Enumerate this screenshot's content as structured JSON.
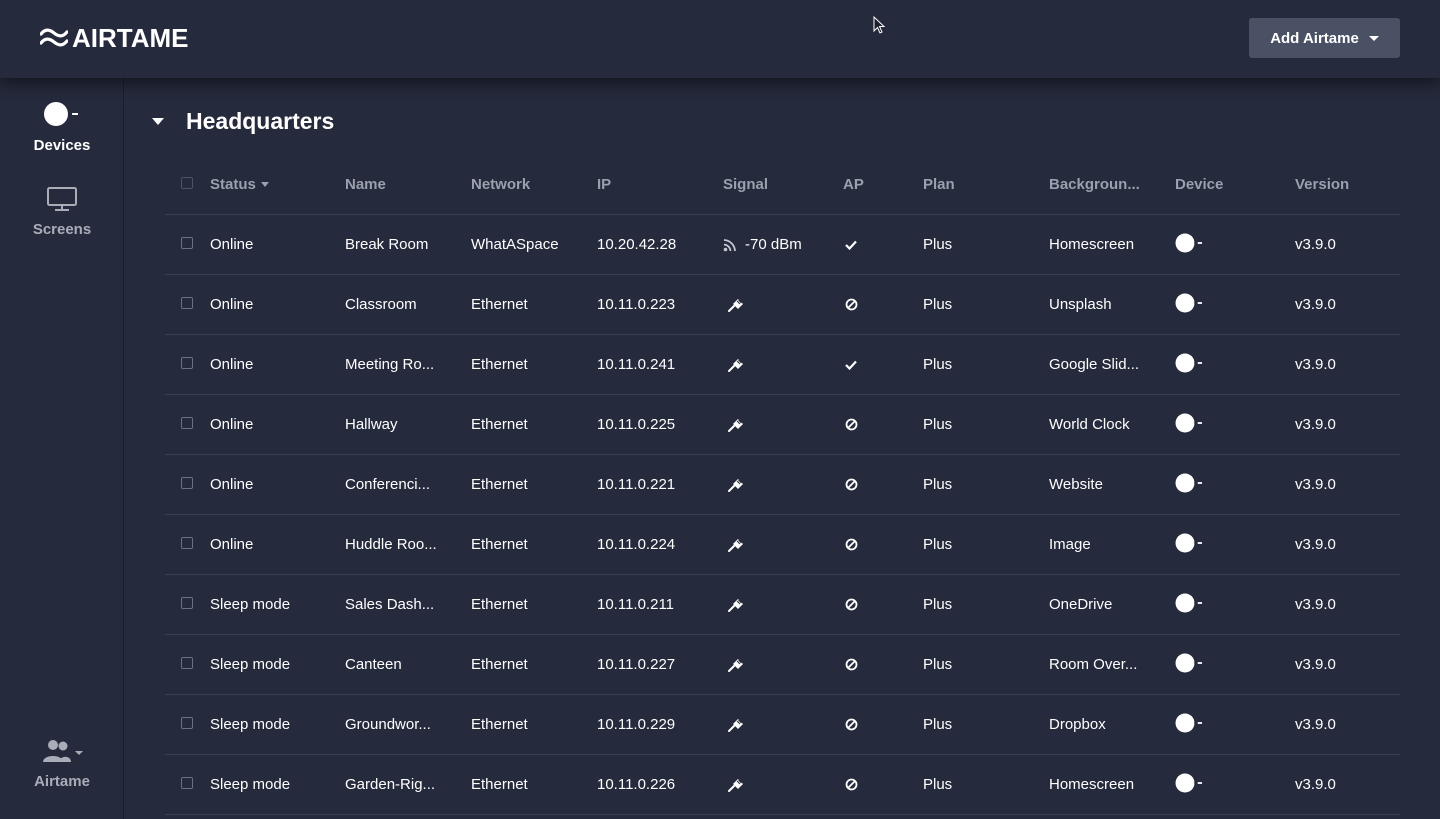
{
  "header": {
    "logo_text": "AIRTAME",
    "add_button_label": "Add Airtame"
  },
  "sidebar": {
    "items": [
      {
        "label": "Devices",
        "icon": "airtame-device-icon",
        "active": true
      },
      {
        "label": "Screens",
        "icon": "monitor-icon",
        "active": false
      }
    ],
    "account_label": "Airtame"
  },
  "group": {
    "title": "Headquarters"
  },
  "table": {
    "columns": [
      "Status",
      "Name",
      "Network",
      "IP",
      "Signal",
      "AP",
      "Plan",
      "Backgroun...",
      "Device",
      "Version"
    ],
    "rows": [
      {
        "status": "Online",
        "name": "Break Room",
        "network": "WhatASpace",
        "ip": "10.20.42.28",
        "signal_type": "wifi",
        "signal": "-70 dBm",
        "ap": "check",
        "plan": "Plus",
        "background": "Homescreen",
        "version": "v3.9.0"
      },
      {
        "status": "Online",
        "name": "Classroom",
        "network": "Ethernet",
        "ip": "10.11.0.223",
        "signal_type": "ethernet",
        "signal": "",
        "ap": "disabled",
        "plan": "Plus",
        "background": "Unsplash",
        "version": "v3.9.0"
      },
      {
        "status": "Online",
        "name": "Meeting Ro...",
        "network": "Ethernet",
        "ip": "10.11.0.241",
        "signal_type": "ethernet",
        "signal": "",
        "ap": "check",
        "plan": "Plus",
        "background": "Google Slid...",
        "version": "v3.9.0"
      },
      {
        "status": "Online",
        "name": "Hallway",
        "network": "Ethernet",
        "ip": "10.11.0.225",
        "signal_type": "ethernet",
        "signal": "",
        "ap": "disabled",
        "plan": "Plus",
        "background": "World Clock",
        "version": "v3.9.0"
      },
      {
        "status": "Online",
        "name": "Conferenci...",
        "network": "Ethernet",
        "ip": "10.11.0.221",
        "signal_type": "ethernet",
        "signal": "",
        "ap": "disabled",
        "plan": "Plus",
        "background": "Website",
        "version": "v3.9.0"
      },
      {
        "status": "Online",
        "name": "Huddle Roo...",
        "network": "Ethernet",
        "ip": "10.11.0.224",
        "signal_type": "ethernet",
        "signal": "",
        "ap": "disabled",
        "plan": "Plus",
        "background": "Image",
        "version": "v3.9.0"
      },
      {
        "status": "Sleep mode",
        "name": "Sales Dash...",
        "network": "Ethernet",
        "ip": "10.11.0.211",
        "signal_type": "ethernet",
        "signal": "",
        "ap": "disabled",
        "plan": "Plus",
        "background": "OneDrive",
        "version": "v3.9.0"
      },
      {
        "status": "Sleep mode",
        "name": "Canteen",
        "network": "Ethernet",
        "ip": "10.11.0.227",
        "signal_type": "ethernet",
        "signal": "",
        "ap": "disabled",
        "plan": "Plus",
        "background": "Room Over...",
        "version": "v3.9.0"
      },
      {
        "status": "Sleep mode",
        "name": "Groundwor...",
        "network": "Ethernet",
        "ip": "10.11.0.229",
        "signal_type": "ethernet",
        "signal": "",
        "ap": "disabled",
        "plan": "Plus",
        "background": "Dropbox",
        "version": "v3.9.0"
      },
      {
        "status": "Sleep mode",
        "name": "Garden-Rig...",
        "network": "Ethernet",
        "ip": "10.11.0.226",
        "signal_type": "ethernet",
        "signal": "",
        "ap": "disabled",
        "plan": "Plus",
        "background": "Homescreen",
        "version": "v3.9.0"
      }
    ]
  },
  "colors": {
    "background": "#252a3c",
    "button": "#4b5164",
    "muted_text": "#9aa0ad",
    "divider": "#3a4052"
  }
}
